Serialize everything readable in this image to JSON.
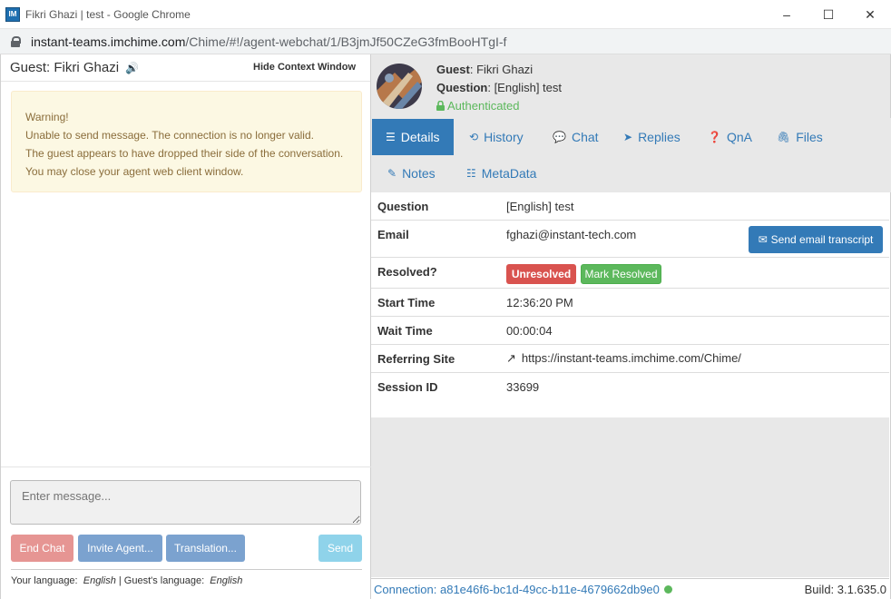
{
  "window": {
    "app_icon": "IM",
    "title": "Fikri Ghazi | test - Google Chrome",
    "url_host": "instant-teams.imchime.com",
    "url_path": "/Chime/#!/agent-webchat/1/B3jmJf50CZeG3fmBooHTgI-f",
    "controls": {
      "minimize": "–",
      "maximize": "☐",
      "close": "✕"
    }
  },
  "left": {
    "guest_title": "Guest: Fikri Ghazi",
    "speaker_icon": "🔊",
    "hide_context": "Hide Context Window",
    "warning": {
      "line1": "Warning!",
      "line2": "Unable to send message. The connection is no longer valid.",
      "line3": "The guest appears to have dropped their side of the conversation.",
      "line4": "You may close your agent web client window."
    },
    "message_placeholder": "Enter message...",
    "buttons": {
      "end_chat": "End Chat",
      "invite_agent": "Invite Agent...",
      "translation": "Translation...",
      "send": "Send"
    },
    "language": {
      "your_label": "Your language:",
      "your_value": "English",
      "separator": "|",
      "guest_label": "Guest's language:",
      "guest_value": "English"
    }
  },
  "profile": {
    "guest_label": "Guest",
    "guest_value": ": Fikri Ghazi",
    "question_label": "Question",
    "question_value": ": [English] test",
    "authenticated": "Authenticated"
  },
  "tabs": [
    {
      "label": "Details",
      "icon": "list-icon"
    },
    {
      "label": "History",
      "icon": "history-icon"
    },
    {
      "label": "Chat",
      "icon": "chat-icon"
    },
    {
      "label": "Replies",
      "icon": "send-icon"
    },
    {
      "label": "QnA",
      "icon": "question-icon"
    },
    {
      "label": "Files",
      "icon": "paperclip-icon"
    },
    {
      "label": "Notes",
      "icon": "edit-icon"
    },
    {
      "label": "MetaData",
      "icon": "table-icon"
    }
  ],
  "details": {
    "question": {
      "label": "Question",
      "value": "[English] test"
    },
    "email": {
      "label": "Email",
      "value": "fghazi@instant-tech.com",
      "button": "Send email transcript"
    },
    "resolved": {
      "label": "Resolved?",
      "badge": "Unresolved",
      "button": "Mark Resolved"
    },
    "start_time": {
      "label": "Start Time",
      "value": "12:36:20 PM"
    },
    "wait_time": {
      "label": "Wait Time",
      "value": "00:00:04"
    },
    "referring_site": {
      "label": "Referring Site",
      "value": "https://instant-teams.imchime.com/Chime/"
    },
    "session_id": {
      "label": "Session ID",
      "value": "33699"
    }
  },
  "status": {
    "connection": "Connection: a81e46f6-bc1d-49cc-b11e-4679662db9e0",
    "build": "Build: 3.1.635.0"
  },
  "colors": {
    "primary": "#337ab7",
    "danger": "#d9534f",
    "success": "#5cb85c",
    "warning_bg": "#fcf8e3",
    "warning_text": "#8a6d3b"
  }
}
